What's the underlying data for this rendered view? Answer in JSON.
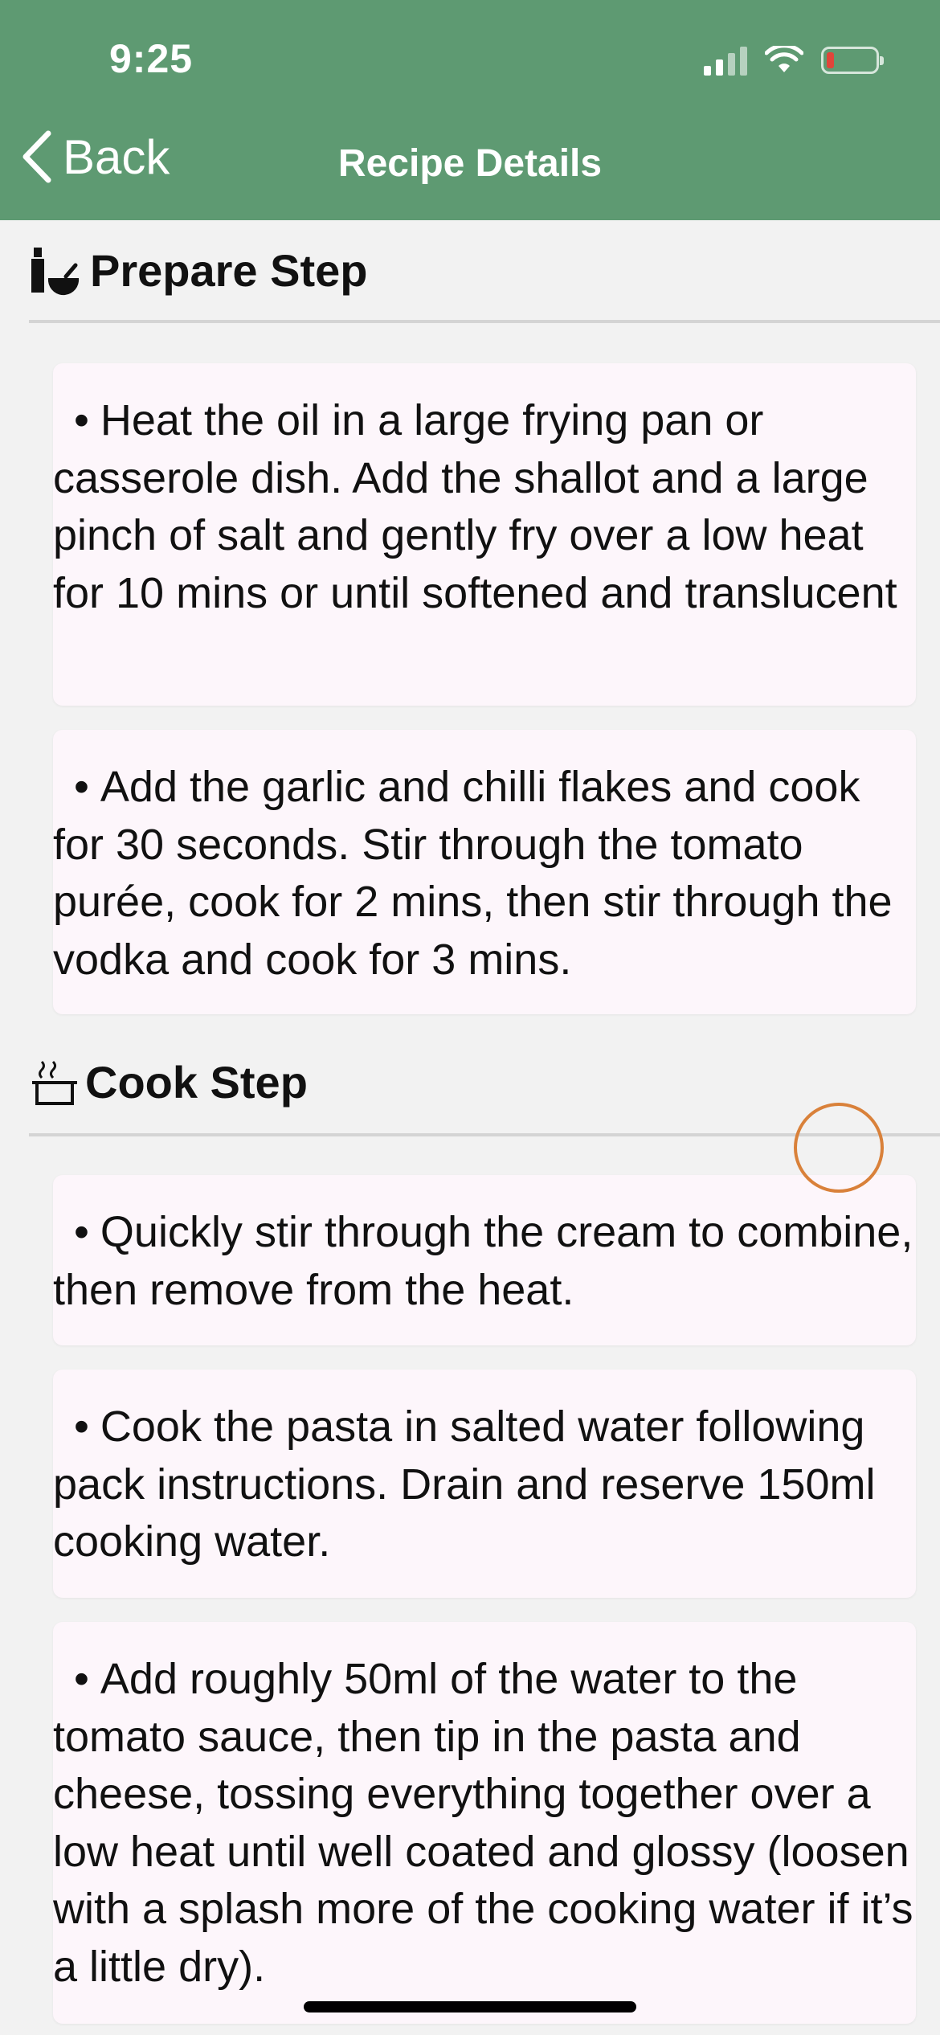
{
  "status_bar": {
    "time": "9:25",
    "icons": [
      "signal-icon",
      "wifi-icon",
      "battery-icon"
    ],
    "battery_color": "#e0453a"
  },
  "nav": {
    "back_label": "Back",
    "title": "Recipe Details",
    "background_color": "#5e9a72"
  },
  "sections": [
    {
      "title": "Prepare Step",
      "icon": "prepare-icon",
      "steps": [
        "Heat the oil in a large frying pan or casserole dish. Add the shallot and a large pinch of salt and gently fry over a low heat for 10 mins or until softened and translucent",
        "Add the garlic and chilli flakes and cook for 30 seconds. Stir through the tomato purée, cook for 2 mins, then stir through the vodka and cook for 3 mins."
      ]
    },
    {
      "title": "Cook Step",
      "icon": "cooking-pot-icon",
      "steps": [
        "Quickly stir through the cream to combine, then remove from the heat.",
        "Cook the pasta in salted water following pack instructions. Drain and reserve 150ml cooking water.",
        "Add roughly 50ml of the water to the tomato sauce, then tip in the pasta and cheese, tossing everything together over a low heat until well coated and glossy (loosen with a splash more of the cooking water if it’s a little dry)."
      ]
    }
  ],
  "bullet": "•"
}
